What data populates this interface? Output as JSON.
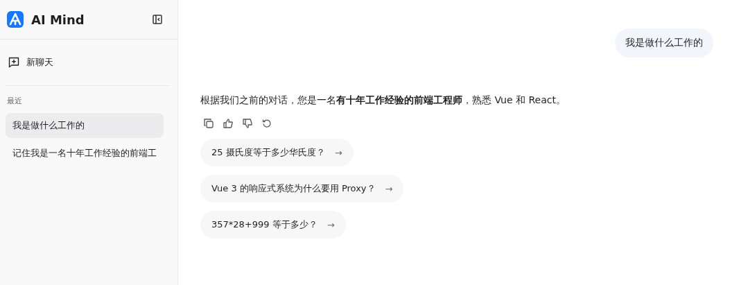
{
  "sidebar": {
    "app_name": "AI Mind",
    "new_chat": "新聊天",
    "section_title": "最近",
    "items": [
      {
        "label": "我是做什么工作的",
        "selected": true
      },
      {
        "label": "记住我是一名十年工作经验的前端工",
        "selected": false
      }
    ]
  },
  "chat": {
    "messages": [
      {
        "kind": "user",
        "text": "我是做什么工作的"
      },
      {
        "kind": "assistant",
        "text": "根据我们之前的对话，您是一名**有十年工作经验的前端工程师**，熟悉 Vue 和 React。"
      }
    ],
    "suggestions": [
      {
        "text": "25 摄氏度等于多少华氏度？",
        "arrow": "→"
      },
      {
        "text": "Vue 3 的响应式系统为什么要用 Proxy？",
        "arrow": "→"
      },
      {
        "text": "357*28+999 等于多少？",
        "arrow": "→"
      }
    ]
  }
}
